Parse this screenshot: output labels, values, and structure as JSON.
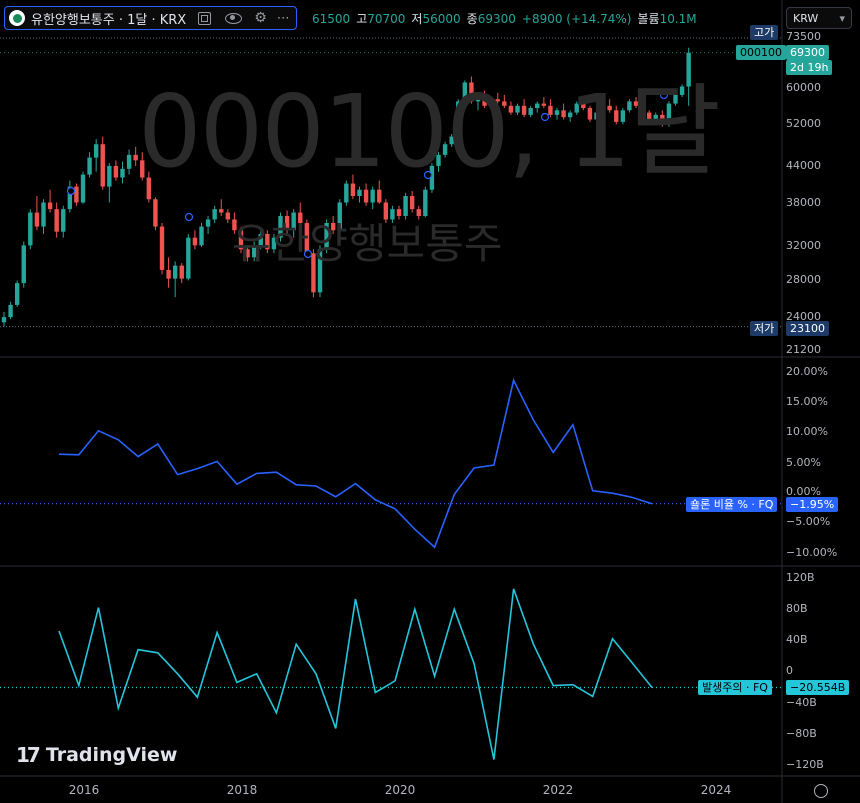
{
  "header": {
    "title": "유한양행보통주 · 1달 · KRX",
    "ohlc_text": [
      {
        "label": "",
        "value": "61500"
      },
      {
        "label": "고",
        "value": "70700"
      },
      {
        "label": "저",
        "value": "56000"
      },
      {
        "label": "종",
        "value": "69300"
      },
      {
        "label": "",
        "value": "+8900 (+14.74%)"
      },
      {
        "label": "볼륨",
        "value": "10.1M"
      }
    ],
    "currency": "KRW",
    "chevron": "▾"
  },
  "watermark": {
    "symbol": "000100, 1달",
    "name": "유한양행보통주"
  },
  "price_axis": {
    "ticks": [
      "73500",
      "60000",
      "52000",
      "44000",
      "38000",
      "32000",
      "28000",
      "24000",
      "21200"
    ],
    "high_label": "고가",
    "high_value": "73500",
    "low_label": "저가",
    "low_value": "23100",
    "symbol_badge": "000100",
    "last_price": "69300",
    "countdown": "2d 19h"
  },
  "indicator1": {
    "label": "숄론 비율 % · FQ",
    "value": "−1.95%",
    "ticks": [
      "20.00%",
      "15.00%",
      "10.00%",
      "5.00%",
      "0.00%",
      "−5.00%",
      "−10.00%"
    ],
    "color": "#2962ff"
  },
  "indicator2": {
    "label": "발생주의 · FQ",
    "value": "−20.554B",
    "ticks": [
      "120B",
      "80B",
      "40B",
      "0",
      "−40B",
      "−80B",
      "−120B"
    ],
    "color": "#26c6da"
  },
  "time_axis": {
    "ticks": [
      "2016",
      "2018",
      "2020",
      "2022",
      "2024"
    ]
  },
  "brand": {
    "name": "TradingView"
  },
  "chart_data": [
    {
      "type": "candlestick",
      "symbol": "000100",
      "interval": "1M",
      "ylim": [
        21200,
        73500
      ],
      "x_range": [
        "2015-01",
        "2024-12"
      ],
      "colors": {
        "up": "#26a69a",
        "down": "#ef5350"
      },
      "ohlc": [
        [
          23500,
          24500,
          23100,
          24000
        ],
        [
          24000,
          25500,
          23800,
          25200
        ],
        [
          25200,
          27800,
          25000,
          27500
        ],
        [
          27500,
          32500,
          27000,
          32000
        ],
        [
          32000,
          37000,
          31500,
          36500
        ],
        [
          36500,
          39000,
          34000,
          34500
        ],
        [
          34500,
          38500,
          33500,
          38000
        ],
        [
          38000,
          40000,
          36500,
          37000
        ],
        [
          37000,
          38000,
          33000,
          33800
        ],
        [
          33800,
          37500,
          33000,
          37000
        ],
        [
          37000,
          41500,
          36500,
          40500
        ],
        [
          40500,
          41000,
          37500,
          38000
        ],
        [
          38000,
          43000,
          37800,
          42500
        ],
        [
          42500,
          46500,
          42000,
          45500
        ],
        [
          45500,
          49000,
          43000,
          48000
        ],
        [
          48000,
          49500,
          40000,
          40500
        ],
        [
          40500,
          44500,
          38000,
          44000
        ],
        [
          44000,
          45000,
          41500,
          42000
        ],
        [
          42000,
          44800,
          41000,
          43500
        ],
        [
          43500,
          47000,
          42500,
          46000
        ],
        [
          46000,
          47500,
          44000,
          45000
        ],
        [
          45000,
          46500,
          41500,
          42000
        ],
        [
          42000,
          43000,
          38000,
          38500
        ],
        [
          38500,
          38800,
          34000,
          34500
        ],
        [
          34500,
          35000,
          28500,
          29000
        ],
        [
          29000,
          30500,
          27000,
          28000
        ],
        [
          28000,
          30000,
          26000,
          29500
        ],
        [
          29500,
          29800,
          27500,
          28000
        ],
        [
          28000,
          33500,
          27800,
          33000
        ],
        [
          33000,
          34000,
          31500,
          32000
        ],
        [
          32000,
          35000,
          31800,
          34500
        ],
        [
          34500,
          36000,
          33500,
          35500
        ],
        [
          35500,
          37500,
          35000,
          37000
        ],
        [
          37000,
          38500,
          36000,
          36500
        ],
        [
          36500,
          37000,
          35000,
          35500
        ],
        [
          35500,
          36500,
          33500,
          34000
        ],
        [
          34000,
          34500,
          31000,
          31500
        ],
        [
          31500,
          32000,
          30000,
          30500
        ],
        [
          30500,
          32500,
          30000,
          32000
        ],
        [
          32000,
          34000,
          31500,
          33500
        ],
        [
          33500,
          34000,
          31000,
          31500
        ],
        [
          31500,
          33500,
          31000,
          33000
        ],
        [
          33000,
          36500,
          32500,
          36000
        ],
        [
          36000,
          36800,
          33500,
          34000
        ],
        [
          34000,
          37000,
          33000,
          36500
        ],
        [
          36500,
          38000,
          34500,
          35000
        ],
        [
          35000,
          35500,
          30500,
          31000
        ],
        [
          31000,
          31500,
          26000,
          26500
        ],
        [
          26500,
          32000,
          26000,
          31500
        ],
        [
          31500,
          35500,
          31000,
          35000
        ],
        [
          35000,
          36000,
          33500,
          34000
        ],
        [
          34000,
          38500,
          33500,
          38000
        ],
        [
          38000,
          41500,
          37500,
          41000
        ],
        [
          41000,
          42500,
          38500,
          39000
        ],
        [
          39000,
          40500,
          38000,
          40000
        ],
        [
          40000,
          41000,
          37500,
          38000
        ],
        [
          38000,
          40500,
          37000,
          40000
        ],
        [
          40000,
          41500,
          37800,
          38000
        ],
        [
          38000,
          38500,
          35000,
          35500
        ],
        [
          35500,
          37500,
          35000,
          37000
        ],
        [
          37000,
          37500,
          35500,
          36000
        ],
        [
          36000,
          39500,
          35500,
          39000
        ],
        [
          39000,
          39800,
          36500,
          37000
        ],
        [
          37000,
          37500,
          35500,
          36000
        ],
        [
          36000,
          40500,
          35800,
          40000
        ],
        [
          40000,
          44500,
          39500,
          44000
        ],
        [
          44000,
          46500,
          43000,
          46000
        ],
        [
          46000,
          48500,
          45500,
          48000
        ],
        [
          48000,
          50000,
          47500,
          49500
        ],
        [
          49500,
          57500,
          49000,
          57000
        ],
        [
          57000,
          62000,
          55500,
          61500
        ],
        [
          61500,
          63000,
          56500,
          57000
        ],
        [
          57000,
          58500,
          55000,
          58000
        ],
        [
          58000,
          59500,
          55500,
          56000
        ],
        [
          56000,
          58000,
          55000,
          57500
        ],
        [
          57500,
          59000,
          56500,
          57000
        ],
        [
          57000,
          58500,
          55500,
          56000
        ],
        [
          56000,
          57000,
          54000,
          54500
        ],
        [
          54500,
          56500,
          54000,
          56000
        ],
        [
          56000,
          57500,
          53500,
          54000
        ],
        [
          54000,
          56000,
          53500,
          55500
        ],
        [
          55500,
          57000,
          54500,
          56500
        ],
        [
          56500,
          58000,
          55500,
          56000
        ],
        [
          56000,
          57500,
          53500,
          54000
        ],
        [
          54000,
          55500,
          53000,
          55000
        ],
        [
          55000,
          56500,
          53000,
          53500
        ],
        [
          53500,
          55000,
          52500,
          54500
        ],
        [
          54500,
          57000,
          54000,
          56500
        ],
        [
          56500,
          58000,
          55000,
          55500
        ],
        [
          55500,
          56000,
          52500,
          53000
        ],
        [
          53000,
          55000,
          52500,
          54500
        ],
        [
          54500,
          56500,
          54000,
          56000
        ],
        [
          56000,
          57500,
          54500,
          55000
        ],
        [
          55000,
          56000,
          52000,
          52500
        ],
        [
          52500,
          55500,
          52000,
          55000
        ],
        [
          55000,
          57500,
          54500,
          57000
        ],
        [
          57000,
          58000,
          55500,
          56000
        ],
        [
          56000,
          56800,
          54000,
          54500
        ],
        [
          54500,
          55000,
          52500,
          53000
        ],
        [
          53000,
          54500,
          52500,
          54000
        ],
        [
          54000,
          55000,
          51500,
          52000
        ],
        [
          52000,
          57000,
          51500,
          56500
        ],
        [
          56500,
          59000,
          56000,
          58500
        ],
        [
          58500,
          61000,
          58000,
          60500
        ],
        [
          60500,
          70700,
          56000,
          69300
        ]
      ]
    },
    {
      "type": "line",
      "name": "숄론 비율 % · FQ",
      "ylim": [
        -11,
        21
      ],
      "x": [
        "2015-09",
        "2015-12",
        "2016-03",
        "2016-06",
        "2016-09",
        "2016-12",
        "2017-03",
        "2017-06",
        "2017-09",
        "2017-12",
        "2018-03",
        "2018-06",
        "2018-09",
        "2018-12",
        "2019-03",
        "2019-06",
        "2019-09",
        "2019-12",
        "2020-03",
        "2020-06",
        "2020-09",
        "2020-12",
        "2021-03",
        "2021-06",
        "2021-09",
        "2021-12",
        "2022-03",
        "2022-06",
        "2022-09",
        "2022-12",
        "2023-03",
        "2023-06"
      ],
      "values": [
        6.3,
        6.2,
        10.2,
        8.7,
        5.9,
        8.0,
        2.9,
        3.9,
        5.1,
        1.3,
        3.1,
        3.3,
        1.2,
        1.0,
        -0.8,
        1.4,
        -1.3,
        -2.8,
        -6.2,
        -9.2,
        -0.4,
        4.0,
        4.5,
        18.6,
        12.0,
        6.6,
        11.2,
        0.2,
        -0.2,
        -0.9,
        -1.95
      ]
    },
    {
      "type": "line",
      "name": "발생주의 · FQ",
      "ylim": [
        -125,
        125
      ],
      "x": [
        "2015-09",
        "2015-12",
        "2016-03",
        "2016-06",
        "2016-09",
        "2016-12",
        "2017-03",
        "2017-06",
        "2017-09",
        "2017-12",
        "2018-03",
        "2018-06",
        "2018-09",
        "2018-12",
        "2019-03",
        "2019-06",
        "2019-09",
        "2019-12",
        "2020-03",
        "2020-06",
        "2020-09",
        "2020-12",
        "2021-03",
        "2021-06",
        "2021-09",
        "2021-12",
        "2022-03",
        "2022-06",
        "2022-09",
        "2022-12",
        "2023-03",
        "2023-06"
      ],
      "values": [
        52,
        -18,
        82,
        -47,
        28,
        24,
        -3,
        -33,
        50,
        -14,
        -3,
        -53,
        35,
        -3,
        -73,
        93,
        -27,
        -12,
        80,
        -6,
        80,
        10,
        -113,
        106,
        35,
        -18,
        -17,
        -32,
        42,
        11,
        -20.554
      ]
    }
  ]
}
